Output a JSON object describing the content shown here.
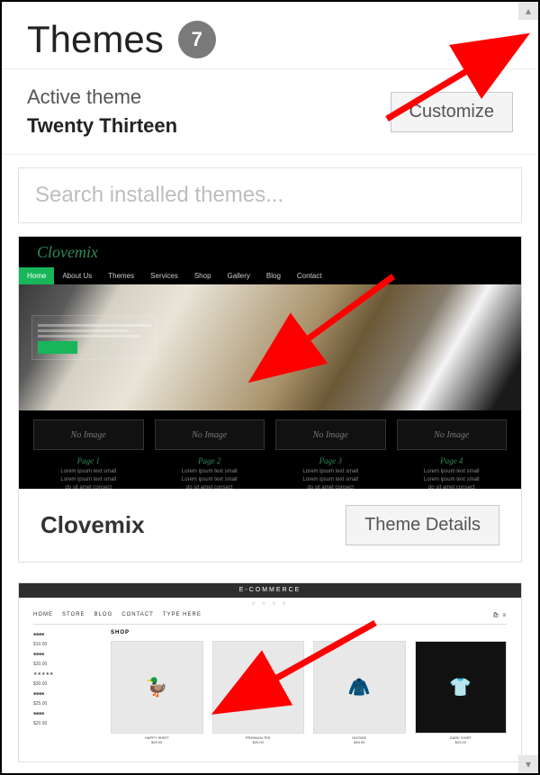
{
  "header": {
    "title": "Themes",
    "count": "7"
  },
  "active": {
    "label": "Active theme",
    "name": "Twenty Thirteen",
    "customize_label": "Customize"
  },
  "search": {
    "placeholder": "Search installed themes..."
  },
  "theme_card": {
    "name": "Clovemix",
    "brand": "Clovemix",
    "nav": [
      "Home",
      "About Us",
      "Themes",
      "Services",
      "Shop",
      "Gallery",
      "Blog",
      "Contact"
    ],
    "no_image": "No Image",
    "details_label": "Theme Details"
  },
  "shop_card": {
    "top": "E-COMMERCE",
    "nav": [
      "HOME",
      "STORE",
      "BLOG",
      "CONTACT",
      "TYPE HERE"
    ],
    "shop_label": "SHOP"
  }
}
